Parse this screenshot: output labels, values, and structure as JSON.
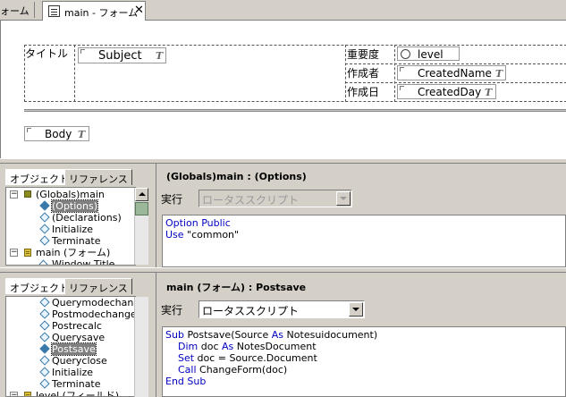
{
  "tabs": {
    "prev_label": "ォーム",
    "active_label": "main - フォーム",
    "close_glyph": "✕"
  },
  "form": {
    "title_label": "タイトル",
    "subject_field": "Subject",
    "priority_label": "重要度",
    "level_field": "level",
    "author_label": "作成者",
    "created_name_field": "CreatedName",
    "date_label": "作成日",
    "created_day_field": "CreatedDay",
    "body_field": "Body",
    "text_type_glyph": "T"
  },
  "panel1": {
    "tab_objects": "オブジェクト",
    "tab_reference": "リファレンス",
    "title": "(Globals)main : (Options)",
    "exec_label": "実行",
    "language": "ロータススクリプト",
    "tree": [
      {
        "label": "(Globals)main",
        "icon": "globals-square-icon",
        "expander": "⊟",
        "indent": 0
      },
      {
        "label": "(Options)",
        "icon": "script-icon",
        "selected": true,
        "indent": 1
      },
      {
        "label": "(Declarations)",
        "icon": "script-icon",
        "indent": 1
      },
      {
        "label": "Initialize",
        "icon": "script-icon",
        "indent": 1
      },
      {
        "label": "Terminate",
        "icon": "script-icon",
        "indent": 1
      },
      {
        "label": "main (フォーム)",
        "icon": "form-icon",
        "expander": "⊟",
        "indent": 0
      },
      {
        "label": "Window Title",
        "icon": "formula-icon",
        "indent": 1
      }
    ],
    "code": [
      [
        {
          "t": "Option Public",
          "k": true
        }
      ],
      [
        {
          "t": "Use ",
          "k": true
        },
        {
          "t": "\"common\"",
          "k": false
        }
      ]
    ]
  },
  "panel2": {
    "tab_objects": "オブジェクト",
    "tab_reference": "リファレンス",
    "title": "main (フォーム) : Postsave",
    "exec_label": "実行",
    "language": "ロータススクリプト",
    "tree": [
      {
        "label": "Querymodechange",
        "icon": "script-icon",
        "indent": 1
      },
      {
        "label": "Postmodechange",
        "icon": "script-icon",
        "indent": 1
      },
      {
        "label": "Postrecalc",
        "icon": "script-icon",
        "indent": 1
      },
      {
        "label": "Querysave",
        "icon": "script-icon",
        "indent": 1
      },
      {
        "label": "Postsave",
        "icon": "script-icon",
        "selected": true,
        "indent": 1
      },
      {
        "label": "Queryclose",
        "icon": "script-icon",
        "indent": 1
      },
      {
        "label": "Initialize",
        "icon": "script-icon",
        "indent": 1
      },
      {
        "label": "Terminate",
        "icon": "script-icon",
        "indent": 1
      },
      {
        "label": "level (フィールド)",
        "icon": "form-icon",
        "expander": "⊟",
        "indent": 0
      }
    ],
    "code": [
      [
        {
          "t": "Sub ",
          "k": true
        },
        {
          "t": "Postsave(Source ",
          "k": false
        },
        {
          "t": "As ",
          "k": true
        },
        {
          "t": "Notesuidocument)",
          "k": false
        }
      ],
      [
        {
          "t": "    Dim ",
          "k": true
        },
        {
          "t": "doc ",
          "k": false
        },
        {
          "t": "As ",
          "k": true
        },
        {
          "t": "NotesDocument",
          "k": false
        }
      ],
      [
        {
          "t": "    Set ",
          "k": true
        },
        {
          "t": "doc = Source.Document",
          "k": false
        }
      ],
      [
        {
          "t": "    Call ",
          "k": true
        },
        {
          "t": "ChangeForm(doc)",
          "k": false
        }
      ],
      [
        {
          "t": "End Sub",
          "k": true
        }
      ]
    ]
  }
}
